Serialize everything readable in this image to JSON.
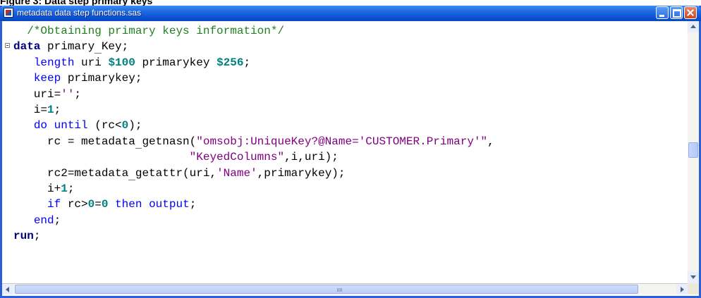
{
  "figure_caption": "Figure 3: Data step primary keys",
  "window": {
    "title": "metadata data step functions.sas",
    "icons": {
      "app": "sas-program-icon",
      "minimize": "minimize-icon",
      "maximize": "maximize-icon",
      "close": "close-icon"
    }
  },
  "editor": {
    "language": "SAS",
    "lines": [
      {
        "fold": false,
        "tokens": [
          {
            "t": "  "
          },
          {
            "t": "/*Obtaining primary keys information*/",
            "k": "comment"
          }
        ]
      },
      {
        "fold": true,
        "tokens": [
          {
            "t": "data",
            "k": "kw-step"
          },
          {
            "t": " primary"
          },
          {
            "t": " ",
            "k": "cursor-underline"
          },
          {
            "t": "Key;"
          }
        ]
      },
      {
        "fold": false,
        "tokens": [
          {
            "t": "   "
          },
          {
            "t": "length",
            "k": "kw"
          },
          {
            "t": " uri "
          },
          {
            "t": "$100",
            "k": "num"
          },
          {
            "t": " primarykey "
          },
          {
            "t": "$256",
            "k": "num"
          },
          {
            "t": ";"
          }
        ]
      },
      {
        "fold": false,
        "tokens": [
          {
            "t": "   "
          },
          {
            "t": "keep",
            "k": "kw"
          },
          {
            "t": " primarykey;"
          }
        ]
      },
      {
        "fold": false,
        "tokens": [
          {
            "t": "   uri="
          },
          {
            "t": "''",
            "k": "str"
          },
          {
            "t": ";"
          }
        ]
      },
      {
        "fold": false,
        "tokens": [
          {
            "t": "   i="
          },
          {
            "t": "1",
            "k": "num"
          },
          {
            "t": ";"
          }
        ]
      },
      {
        "fold": false,
        "tokens": [
          {
            "t": "   "
          },
          {
            "t": "do until",
            "k": "kw"
          },
          {
            "t": " (rc<"
          },
          {
            "t": "0",
            "k": "num"
          },
          {
            "t": ");"
          }
        ]
      },
      {
        "fold": false,
        "tokens": [
          {
            "t": "     rc = metadata"
          },
          {
            "t": " ",
            "k": "cursor-underline"
          },
          {
            "t": "getnasn("
          },
          {
            "t": "\"omsobj:UniqueKey?@Name='CUSTOMER.Primary'\"",
            "k": "str"
          },
          {
            "t": ","
          }
        ]
      },
      {
        "fold": false,
        "tokens": [
          {
            "t": "                          "
          },
          {
            "t": "\"KeyedColumns\"",
            "k": "str"
          },
          {
            "t": ",i,uri);"
          }
        ]
      },
      {
        "fold": false,
        "tokens": [
          {
            "t": "     rc2=metadata"
          },
          {
            "t": " ",
            "k": "cursor-underline"
          },
          {
            "t": "getattr(uri,"
          },
          {
            "t": "'Name'",
            "k": "str"
          },
          {
            "t": ",primarykey);"
          }
        ]
      },
      {
        "fold": false,
        "tokens": [
          {
            "t": "     i+"
          },
          {
            "t": "1",
            "k": "num"
          },
          {
            "t": ";"
          }
        ]
      },
      {
        "fold": false,
        "tokens": [
          {
            "t": "     "
          },
          {
            "t": "if",
            "k": "kw"
          },
          {
            "t": " rc>"
          },
          {
            "t": "0",
            "k": "num"
          },
          {
            "t": "="
          },
          {
            "t": "0",
            "k": "num"
          },
          {
            "t": " "
          },
          {
            "t": "then output",
            "k": "kw"
          },
          {
            "t": ";"
          }
        ]
      },
      {
        "fold": false,
        "tokens": [
          {
            "t": "   "
          },
          {
            "t": "end",
            "k": "kw"
          },
          {
            "t": ";"
          }
        ]
      },
      {
        "fold": false,
        "tokens": [
          {
            "t": "run",
            "k": "kw-step"
          },
          {
            "t": ";"
          }
        ]
      }
    ]
  },
  "scrollbars": {
    "icons": [
      "scroll-up-icon",
      "scroll-down-icon",
      "scroll-left-icon",
      "scroll-right-icon"
    ]
  }
}
